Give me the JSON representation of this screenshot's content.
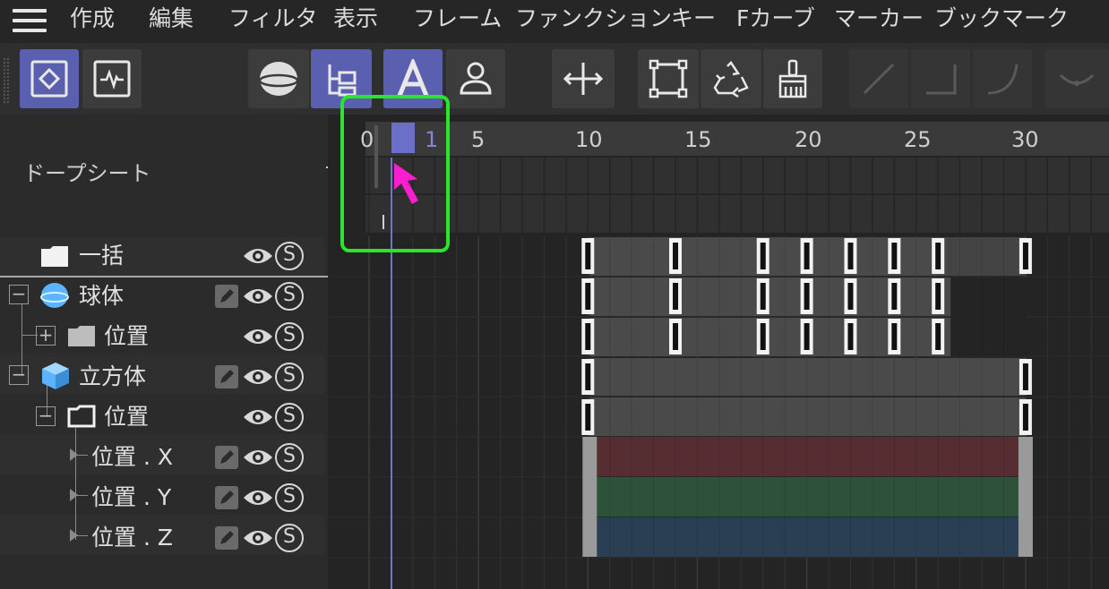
{
  "menu": {
    "items": [
      "作成",
      "編集",
      "フィルタ",
      "表示",
      "フレーム",
      "ファンクション",
      "キー",
      "Fカーブ",
      "マーカー",
      "ブックマーク"
    ]
  },
  "toolbar": {
    "buttons": [
      {
        "name": "dopesheet-mode",
        "icon": "keyframe-diamond-icon",
        "active": true
      },
      {
        "name": "fcurve-mode",
        "icon": "curve-graph-icon",
        "active": false
      },
      {
        "name": "object-mode",
        "icon": "sphere-icon",
        "active": false
      },
      {
        "name": "hierarchy-mode",
        "icon": "hierarchy-icon",
        "active": true
      },
      {
        "name": "animated-only",
        "icon": "letter-a-icon",
        "active": true
      },
      {
        "name": "user-mode",
        "icon": "person-icon",
        "active": false
      },
      {
        "name": "move",
        "icon": "move-arrows-icon",
        "active": false
      },
      {
        "name": "frame-all",
        "icon": "frame-icon",
        "active": false
      },
      {
        "name": "recycle",
        "icon": "recycle-icon",
        "active": false
      },
      {
        "name": "clean",
        "icon": "broom-icon",
        "active": false
      },
      {
        "name": "linear",
        "icon": "linear-icon",
        "active": false
      },
      {
        "name": "step",
        "icon": "step-icon",
        "active": false
      },
      {
        "name": "spline",
        "icon": "spline-icon",
        "active": false
      },
      {
        "name": "ease",
        "icon": "ease-icon",
        "active": false
      }
    ]
  },
  "panel": {
    "title": "ドープシート"
  },
  "tree": [
    {
      "label": "一括",
      "icon": "folder-filled-icon",
      "expander": ""
    },
    {
      "label": "球体",
      "icon": "sphere-icon",
      "expander": "⊟"
    },
    {
      "label": "位置",
      "icon": "folder-filled-icon",
      "expander": "⊞"
    },
    {
      "label": "立方体",
      "icon": "cube-icon",
      "expander": "⊟"
    },
    {
      "label": "位置",
      "icon": "folder-outline-icon",
      "expander": "⊟"
    },
    {
      "label": "位置 . X",
      "icon": "triangle-right-icon",
      "expander": ""
    },
    {
      "label": "位置 . Y",
      "icon": "triangle-right-icon",
      "expander": ""
    },
    {
      "label": "位置 . Z",
      "icon": "triangle-right-icon",
      "expander": ""
    }
  ],
  "ruler": {
    "ticks": [
      "0",
      "1",
      "5",
      "10",
      "15",
      "20",
      "25",
      "30"
    ],
    "current_frame": "1"
  },
  "colors": {
    "accent": "#6b6fc9",
    "highlight_box": "#28e628",
    "cursor": "#ff1ecf",
    "track_x": "#562e32",
    "track_y": "#2d523a",
    "track_z": "#2a3e54"
  },
  "keyframes": {
    "summary": [
      10,
      14,
      18,
      20,
      22,
      24,
      26,
      30
    ],
    "sphere": [
      10,
      14,
      18,
      20,
      22,
      24,
      26
    ],
    "sphere_position": [
      10,
      14,
      18,
      20,
      22,
      24,
      26
    ],
    "cube": [
      10,
      30
    ],
    "cube_position": [
      10,
      30
    ]
  }
}
